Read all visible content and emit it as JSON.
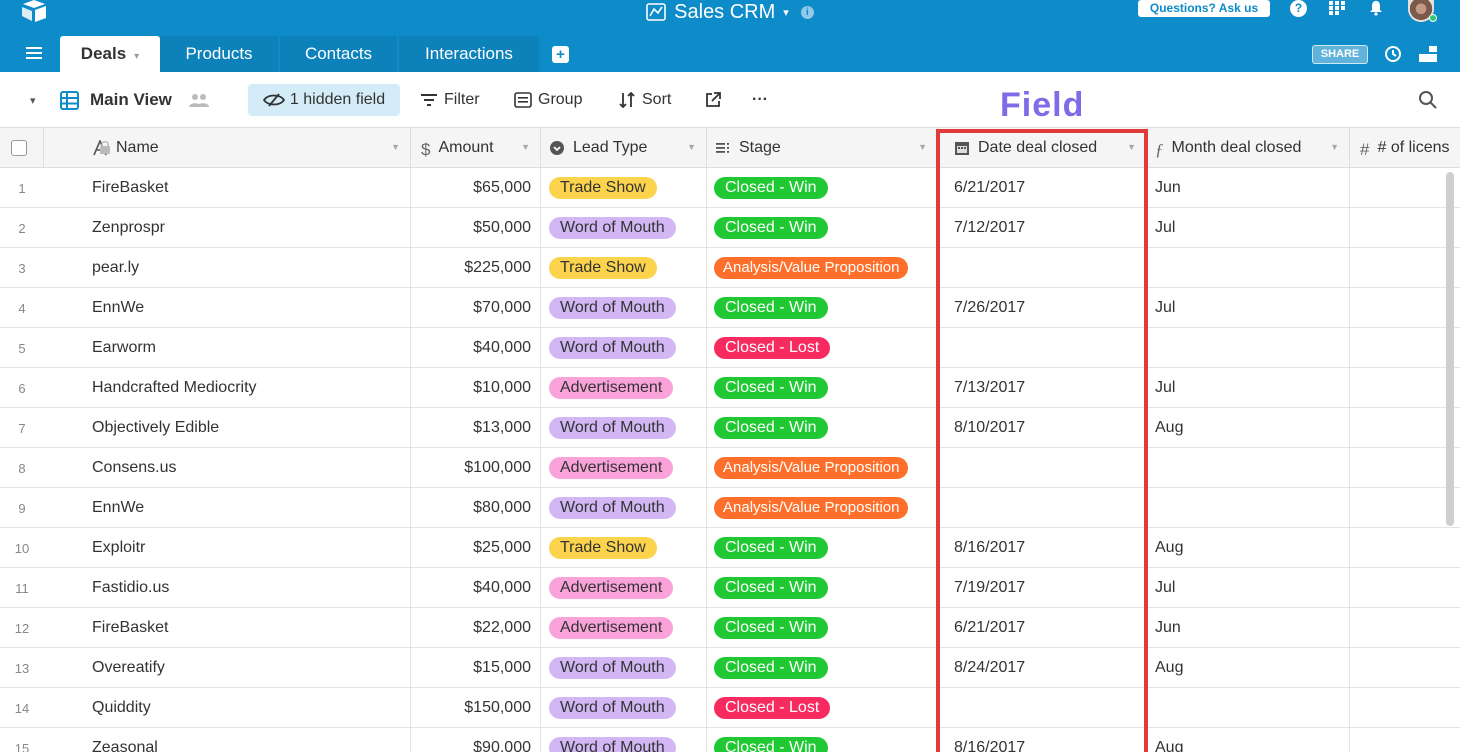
{
  "app": {
    "title": "Sales CRM",
    "title_caret": "▾",
    "info": "i",
    "questions_label": "Questions? Ask us",
    "help_label": "?"
  },
  "tabs": [
    {
      "label": "Deals",
      "caret": "▾",
      "active": true
    },
    {
      "label": "Products"
    },
    {
      "label": "Contacts"
    },
    {
      "label": "Interactions"
    }
  ],
  "add_tab_label": "+",
  "share_label": "SHARE",
  "viewbar": {
    "caret": "▾",
    "view_name": "Main View",
    "hidden_field_label": "1 hidden field",
    "filter_label": "Filter",
    "group_label": "Group",
    "sort_label": "Sort",
    "more_label": "···"
  },
  "annotation": {
    "label": "Field"
  },
  "columns": {
    "name": "Name",
    "amount": "Amount",
    "lead_type": "Lead Type",
    "stage": "Stage",
    "date": "Date deal closed",
    "month": "Month deal closed",
    "licenses": "# of licens"
  },
  "colors": {
    "topbar": "#0e8bc9",
    "trade_show": "#fcd34d",
    "word_of_mouth": "#d2b7f4",
    "advertisement": "#f9a3da",
    "closed_win": "#20c933",
    "closed_lost": "#f82b60",
    "analysis": "#ff6f2c",
    "highlight": "#e03a3a",
    "annotation": "#7d6be8"
  },
  "rows": [
    {
      "num": "1",
      "name": "FireBasket",
      "amount": "$65,000",
      "lead": "Trade Show",
      "lead_kind": "trade",
      "stage": "Closed - Win",
      "stage_kind": "win",
      "date": "6/21/2017",
      "month": "Jun"
    },
    {
      "num": "2",
      "name": "Zenprospr",
      "amount": "$50,000",
      "lead": "Word of Mouth",
      "lead_kind": "word",
      "stage": "Closed - Win",
      "stage_kind": "win",
      "date": "7/12/2017",
      "month": "Jul"
    },
    {
      "num": "3",
      "name": "pear.ly",
      "amount": "$225,000",
      "lead": "Trade Show",
      "lead_kind": "trade",
      "stage": "Analysis/Value Proposition",
      "stage_kind": "analysis",
      "date": "",
      "month": ""
    },
    {
      "num": "4",
      "name": "EnnWe",
      "amount": "$70,000",
      "lead": "Word of Mouth",
      "lead_kind": "word",
      "stage": "Closed - Win",
      "stage_kind": "win",
      "date": "7/26/2017",
      "month": "Jul"
    },
    {
      "num": "5",
      "name": "Earworm",
      "amount": "$40,000",
      "lead": "Word of Mouth",
      "lead_kind": "word",
      "stage": "Closed - Lost",
      "stage_kind": "lost",
      "date": "",
      "month": ""
    },
    {
      "num": "6",
      "name": "Handcrafted Mediocrity",
      "amount": "$10,000",
      "lead": "Advertisement",
      "lead_kind": "adv",
      "stage": "Closed - Win",
      "stage_kind": "win",
      "date": "7/13/2017",
      "month": "Jul"
    },
    {
      "num": "7",
      "name": "Objectively Edible",
      "amount": "$13,000",
      "lead": "Word of Mouth",
      "lead_kind": "word",
      "stage": "Closed - Win",
      "stage_kind": "win",
      "date": "8/10/2017",
      "month": "Aug"
    },
    {
      "num": "8",
      "name": "Consens.us",
      "amount": "$100,000",
      "lead": "Advertisement",
      "lead_kind": "adv",
      "stage": "Analysis/Value Proposition",
      "stage_kind": "analysis",
      "date": "",
      "month": ""
    },
    {
      "num": "9",
      "name": "EnnWe",
      "amount": "$80,000",
      "lead": "Word of Mouth",
      "lead_kind": "word",
      "stage": "Analysis/Value Proposition",
      "stage_kind": "analysis",
      "date": "",
      "month": ""
    },
    {
      "num": "10",
      "name": "Exploitr",
      "amount": "$25,000",
      "lead": "Trade Show",
      "lead_kind": "trade",
      "stage": "Closed - Win",
      "stage_kind": "win",
      "date": "8/16/2017",
      "month": "Aug"
    },
    {
      "num": "11",
      "name": "Fastidio.us",
      "amount": "$40,000",
      "lead": "Advertisement",
      "lead_kind": "adv",
      "stage": "Closed - Win",
      "stage_kind": "win",
      "date": "7/19/2017",
      "month": "Jul"
    },
    {
      "num": "12",
      "name": "FireBasket",
      "amount": "$22,000",
      "lead": "Advertisement",
      "lead_kind": "adv",
      "stage": "Closed - Win",
      "stage_kind": "win",
      "date": "6/21/2017",
      "month": "Jun"
    },
    {
      "num": "13",
      "name": "Overeatify",
      "amount": "$15,000",
      "lead": "Word of Mouth",
      "lead_kind": "word",
      "stage": "Closed - Win",
      "stage_kind": "win",
      "date": "8/24/2017",
      "month": "Aug"
    },
    {
      "num": "14",
      "name": "Quiddity",
      "amount": "$150,000",
      "lead": "Word of Mouth",
      "lead_kind": "word",
      "stage": "Closed - Lost",
      "stage_kind": "lost",
      "date": "",
      "month": ""
    },
    {
      "num": "15",
      "name": "Zeasonal",
      "amount": "$90,000",
      "lead": "Word of Mouth",
      "lead_kind": "word",
      "stage": "Closed - Win",
      "stage_kind": "win",
      "date": "8/16/2017",
      "month": "Aug"
    }
  ]
}
